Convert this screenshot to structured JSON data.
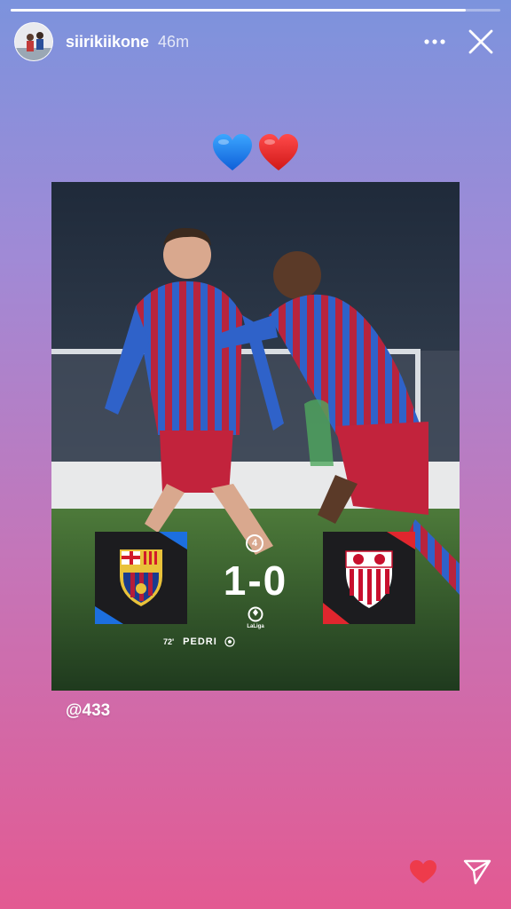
{
  "story": {
    "progress_percent": 93
  },
  "header": {
    "username": "siirikiikone",
    "timestamp": "46m",
    "more_icon": "more-horizontal-icon",
    "close_icon": "close-icon"
  },
  "sticker": {
    "hearts": [
      "blue-heart",
      "red-heart"
    ]
  },
  "post": {
    "home_team_crest": "fc-barcelona-crest",
    "away_team_crest": "sevilla-fc-crest",
    "score": "1-0",
    "matchday": "4",
    "league_logo_text": "LaLiga",
    "scorer_minute": "72'",
    "scorer_name": "PEDRI",
    "goal_icon": "football-icon",
    "mention": "@433"
  },
  "footer": {
    "like_icon": "heart-icon",
    "share_icon": "send-icon"
  },
  "colors": {
    "brand_blue": "#1c6fe0",
    "brand_red": "#e0262e",
    "like_red": "#ee3b4b"
  }
}
